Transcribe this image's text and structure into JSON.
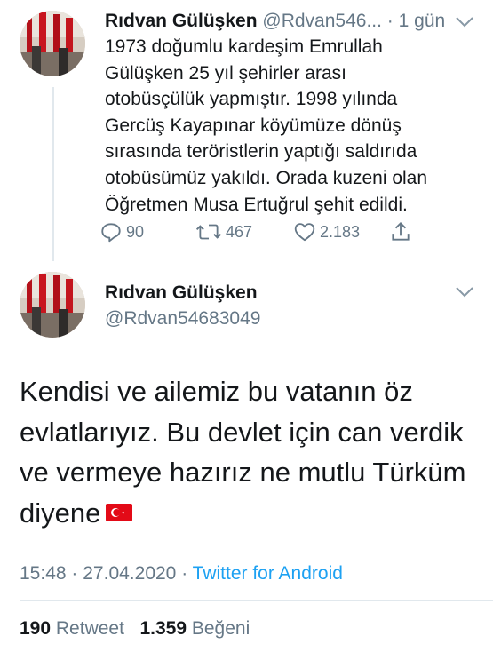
{
  "tweet1": {
    "name": "Rıdvan Gülüşken",
    "handle": "@Rdvan546...",
    "separator": "·",
    "time": "1 gün",
    "lines": [
      "1973 doğumlu kardeşim Emrullah",
      "Gülüşken 25 yıl şehirler arası",
      "otobüsçülük yapmıştır. 1998 yılında",
      "Gercüş Kayapınar köyümüze dönüş",
      "sırasında teröristlerin yaptığı saldırıda",
      "otobüsümüz yakıldı. Orada kuzeni olan",
      "Öğretmen Musa Ertuğrul şehit edildi."
    ],
    "replies": "90",
    "retweets": "467",
    "likes": "2.183"
  },
  "tweet2": {
    "name": "Rıdvan Gülüşken",
    "handle": "@Rdvan54683049",
    "lines": [
      "Kendisi ve ailemiz bu vatanın öz",
      "evlatlarıyız. Bu devlet için can verdik",
      "ve vermeye hazırız ne mutlu Türküm",
      "diyene"
    ],
    "emoji": "turkey-flag-emoji",
    "time": "15:48",
    "separator": "·",
    "date": "27.04.2020",
    "source": "Twitter for Android",
    "retweet_count": "190",
    "retweet_label": "Retweet",
    "like_count": "1.359",
    "like_label": "Beğeni"
  },
  "colors": {
    "text": "#14171a",
    "secondary": "#657786",
    "link": "#1da1f2",
    "flag_red": "#e30a17"
  }
}
